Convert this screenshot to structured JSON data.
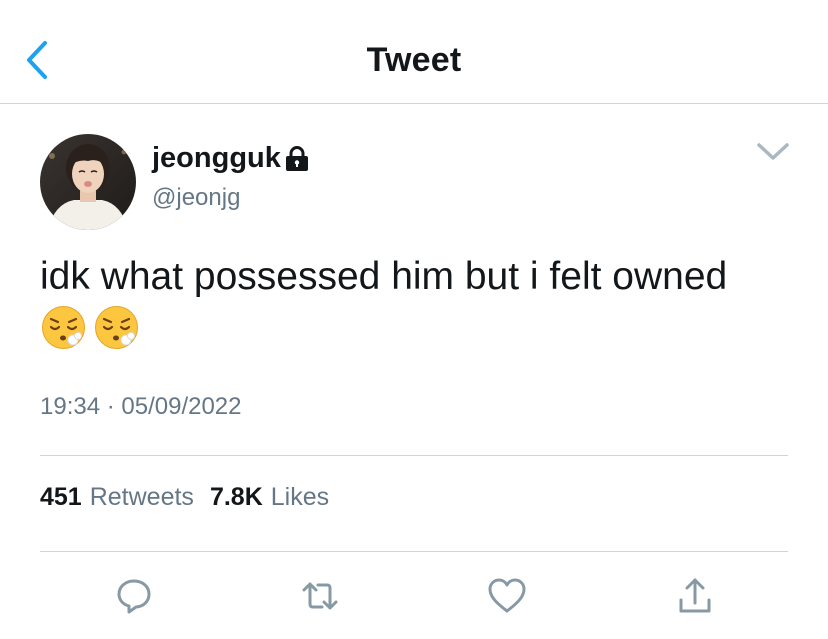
{
  "nav": {
    "title": "Tweet",
    "back_icon": "chevron-left-icon"
  },
  "author": {
    "display_name": "jeongguk",
    "handle": "@jeonjg",
    "protected_icon": "lock-icon"
  },
  "tweet": {
    "text": "idk what possessed him but i felt owned",
    "emojis": [
      "face-exhaling",
      "face-exhaling"
    ],
    "timestamp": "19:34 · 05/09/2022"
  },
  "stats": {
    "retweets_count": "451",
    "retweets_label": "Retweets",
    "likes_count": "7.8K",
    "likes_label": "Likes"
  },
  "actions": [
    "reply-icon",
    "retweet-icon",
    "like-icon",
    "share-icon"
  ],
  "colors": {
    "accent": "#1da1f2",
    "secondary_text": "#657786",
    "primary_text": "#14171a",
    "divider": "#cfd4d8",
    "icon": "#8899a6"
  }
}
